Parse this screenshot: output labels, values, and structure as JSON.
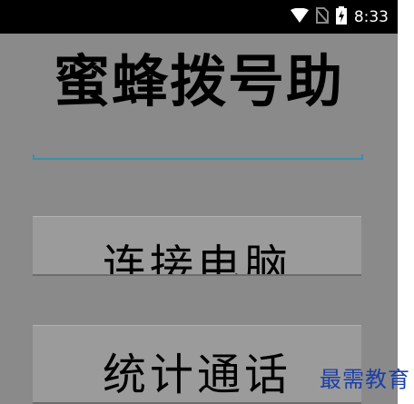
{
  "status_bar": {
    "time": "8:33",
    "icons": [
      "wifi-icon",
      "no-sim-icon",
      "battery-charging-icon"
    ]
  },
  "app": {
    "title": "蜜蜂拨号助",
    "input": {
      "value": "",
      "placeholder": ""
    },
    "buttons": {
      "connect_label": "连接电脑",
      "stats_label": "统计通话"
    }
  },
  "watermark": "最需教育",
  "colors": {
    "background": "#8a8a8a",
    "status_bar": "#000000",
    "accent": "#3f8ea8",
    "watermark": "#1a3fa8"
  }
}
